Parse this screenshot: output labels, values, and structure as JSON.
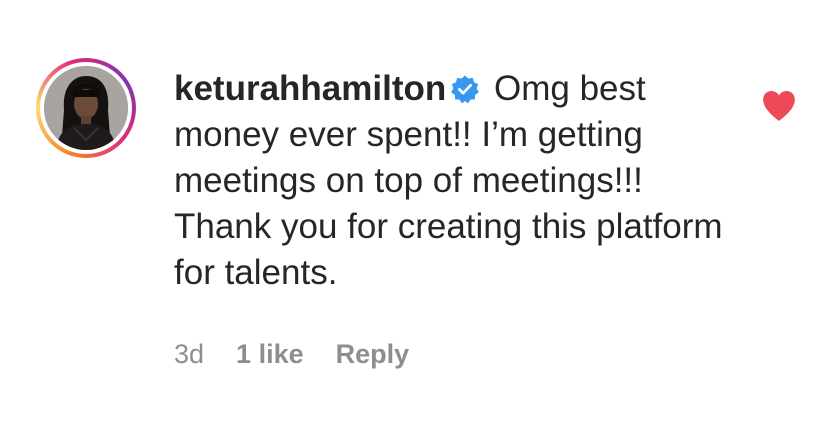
{
  "comment": {
    "username": "keturahhamilton",
    "verified": true,
    "text": "Omg best money ever spent!! I’m getting meetings on top of meetings!!! Thank you for creating this platform for talents.",
    "liked": true,
    "heart_color": "#ed4956",
    "verified_color": "#3897f0"
  },
  "meta": {
    "time": "3d",
    "likes": "1 like",
    "reply_label": "Reply"
  },
  "avatar": {
    "icon": "user-avatar",
    "story_ring_colors": [
      "#f58529",
      "#dd2a7b",
      "#8134af"
    ]
  }
}
